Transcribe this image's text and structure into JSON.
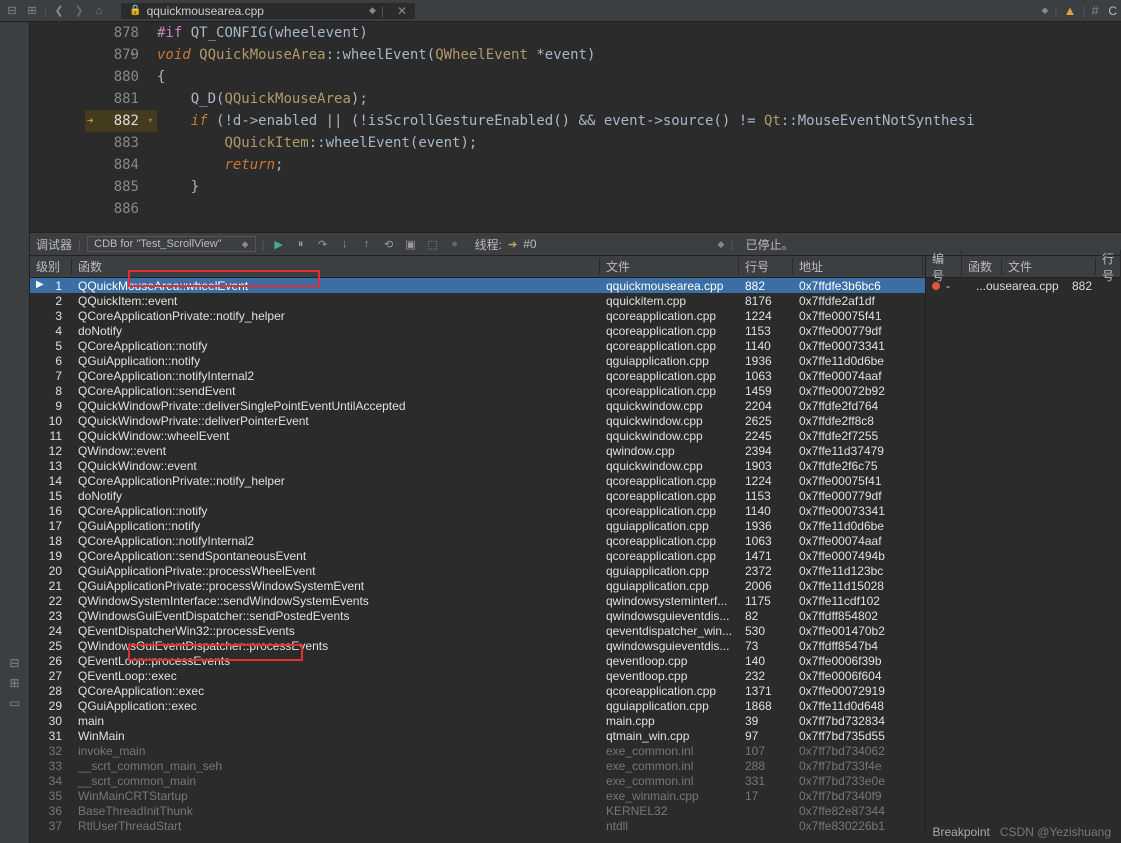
{
  "toolbar": {
    "filename": "qquickmousearea.cpp",
    "hash_label": "C"
  },
  "editor": {
    "lines": [
      {
        "num": "878",
        "html": "<span class='kw-pre'>#if</span> <span class='fn'>QT_CONFIG</span><span class='paren'>(</span><span class='fn'>wheelevent</span><span class='paren'>)</span>"
      },
      {
        "num": "879",
        "html": "<span class='kw'>void</span> <span class='type'>QQuickMouseArea</span><span class='str-op'>::</span><span class='fn'>wheelEvent</span><span class='paren'>(</span><span class='type'>QWheelEvent</span> <span class='str-op'>*</span><span class='fn'>event</span><span class='paren'>)</span>",
        "fold": true
      },
      {
        "num": "880",
        "html": "<span class='paren'>{</span>"
      },
      {
        "num": "881",
        "html": "    <span class='fn'>Q_D</span><span class='paren'>(</span><span class='type'>QQuickMouseArea</span><span class='paren'>);</span>"
      },
      {
        "num": "882",
        "html": "    <span class='kw'>if</span> <span class='paren'>(!</span><span class='fn'>d</span><span class='str-op'>-&gt;</span><span class='fn'>enabled</span> <span class='str-op'>||</span> <span class='paren'>(!</span><span class='fn'>isScrollGestureEnabled</span><span class='paren'>()</span> <span class='str-op'>&amp;&amp;</span> <span class='fn'>event</span><span class='str-op'>-&gt;</span><span class='fn'>source</span><span class='paren'>()</span> <span class='str-op'>!=</span> <span class='type'>Qt</span><span class='str-op'>::</span><span class='fn'>MouseEventNotSynthesi</span>",
        "arrow": true,
        "hl": true,
        "fold": true
      },
      {
        "num": "883",
        "html": "        <span class='type'>QQuickItem</span><span class='str-op'>::</span><span class='fn'>wheelEvent</span><span class='paren'>(</span><span class='fn'>event</span><span class='paren'>);</span>"
      },
      {
        "num": "884",
        "html": "        <span class='kw'>return</span><span class='paren'>;</span>"
      },
      {
        "num": "885",
        "html": "    <span class='paren'>}</span>"
      },
      {
        "num": "886",
        "html": ""
      }
    ]
  },
  "debugger": {
    "label": "调试器",
    "target": "CDB for \"Test_ScrollView\"",
    "threads_label": "线程:",
    "thread_num": "#0",
    "status": "已停止。"
  },
  "stack_headers": {
    "level": "级别",
    "func": "函数",
    "file": "文件",
    "line": "行号",
    "addr": "地址"
  },
  "side_headers": {
    "num": "编号",
    "func": "函数",
    "file": "文件",
    "line": "行号"
  },
  "side_row": {
    "dash": "-",
    "file": "...ousearea.cpp",
    "line": "882"
  },
  "stack": [
    {
      "lvl": "1",
      "fn": "QQuickMouseArea::wheelEvent",
      "file": "qquickmousearea.cpp",
      "line": "882",
      "addr": "0x7ffdfe3b6bc6",
      "sel": true,
      "ptr": true
    },
    {
      "lvl": "2",
      "fn": "QQuickItem::event",
      "file": "qquickitem.cpp",
      "line": "8176",
      "addr": "0x7ffdfe2af1df"
    },
    {
      "lvl": "3",
      "fn": "QCoreApplicationPrivate::notify_helper",
      "file": "qcoreapplication.cpp",
      "line": "1224",
      "addr": "0x7ffe00075f41"
    },
    {
      "lvl": "4",
      "fn": "doNotify",
      "file": "qcoreapplication.cpp",
      "line": "1153",
      "addr": "0x7ffe000779df"
    },
    {
      "lvl": "5",
      "fn": "QCoreApplication::notify",
      "file": "qcoreapplication.cpp",
      "line": "1140",
      "addr": "0x7ffe00073341"
    },
    {
      "lvl": "6",
      "fn": "QGuiApplication::notify",
      "file": "qguiapplication.cpp",
      "line": "1936",
      "addr": "0x7ffe11d0d6be"
    },
    {
      "lvl": "7",
      "fn": "QCoreApplication::notifyInternal2",
      "file": "qcoreapplication.cpp",
      "line": "1063",
      "addr": "0x7ffe00074aaf"
    },
    {
      "lvl": "8",
      "fn": "QCoreApplication::sendEvent",
      "file": "qcoreapplication.cpp",
      "line": "1459",
      "addr": "0x7ffe00072b92"
    },
    {
      "lvl": "9",
      "fn": "QQuickWindowPrivate::deliverSinglePointEventUntilAccepted",
      "file": "qquickwindow.cpp",
      "line": "2204",
      "addr": "0x7ffdfe2fd764"
    },
    {
      "lvl": "10",
      "fn": "QQuickWindowPrivate::deliverPointerEvent",
      "file": "qquickwindow.cpp",
      "line": "2625",
      "addr": "0x7ffdfe2ff8c8"
    },
    {
      "lvl": "11",
      "fn": "QQuickWindow::wheelEvent",
      "file": "qquickwindow.cpp",
      "line": "2245",
      "addr": "0x7ffdfe2f7255"
    },
    {
      "lvl": "12",
      "fn": "QWindow::event",
      "file": "qwindow.cpp",
      "line": "2394",
      "addr": "0x7ffe11d37479"
    },
    {
      "lvl": "13",
      "fn": "QQuickWindow::event",
      "file": "qquickwindow.cpp",
      "line": "1903",
      "addr": "0x7ffdfe2f6c75"
    },
    {
      "lvl": "14",
      "fn": "QCoreApplicationPrivate::notify_helper",
      "file": "qcoreapplication.cpp",
      "line": "1224",
      "addr": "0x7ffe00075f41"
    },
    {
      "lvl": "15",
      "fn": "doNotify",
      "file": "qcoreapplication.cpp",
      "line": "1153",
      "addr": "0x7ffe000779df"
    },
    {
      "lvl": "16",
      "fn": "QCoreApplication::notify",
      "file": "qcoreapplication.cpp",
      "line": "1140",
      "addr": "0x7ffe00073341"
    },
    {
      "lvl": "17",
      "fn": "QGuiApplication::notify",
      "file": "qguiapplication.cpp",
      "line": "1936",
      "addr": "0x7ffe11d0d6be"
    },
    {
      "lvl": "18",
      "fn": "QCoreApplication::notifyInternal2",
      "file": "qcoreapplication.cpp",
      "line": "1063",
      "addr": "0x7ffe00074aaf"
    },
    {
      "lvl": "19",
      "fn": "QCoreApplication::sendSpontaneousEvent",
      "file": "qcoreapplication.cpp",
      "line": "1471",
      "addr": "0x7ffe0007494b"
    },
    {
      "lvl": "20",
      "fn": "QGuiApplicationPrivate::processWheelEvent",
      "file": "qguiapplication.cpp",
      "line": "2372",
      "addr": "0x7ffe11d123bc"
    },
    {
      "lvl": "21",
      "fn": "QGuiApplicationPrivate::processWindowSystemEvent",
      "file": "qguiapplication.cpp",
      "line": "2006",
      "addr": "0x7ffe11d15028"
    },
    {
      "lvl": "22",
      "fn": "QWindowSystemInterface::sendWindowSystemEvents",
      "file": "qwindowsysteminterf...",
      "line": "1175",
      "addr": "0x7ffe11cdf102"
    },
    {
      "lvl": "23",
      "fn": "QWindowsGuiEventDispatcher::sendPostedEvents",
      "file": "qwindowsguieventdis...",
      "line": "82",
      "addr": "0x7ffdff854802"
    },
    {
      "lvl": "24",
      "fn": "QEventDispatcherWin32::processEvents",
      "file": "qeventdispatcher_win...",
      "line": "530",
      "addr": "0x7ffe001470b2"
    },
    {
      "lvl": "25",
      "fn": "QWindowsGuiEventDispatcher::processEvents",
      "file": "qwindowsguieventdis...",
      "line": "73",
      "addr": "0x7ffdff8547b4"
    },
    {
      "lvl": "26",
      "fn": "QEventLoop::processEvents",
      "file": "qeventloop.cpp",
      "line": "140",
      "addr": "0x7ffe0006f39b"
    },
    {
      "lvl": "27",
      "fn": "QEventLoop::exec",
      "file": "qeventloop.cpp",
      "line": "232",
      "addr": "0x7ffe0006f604"
    },
    {
      "lvl": "28",
      "fn": "QCoreApplication::exec",
      "file": "qcoreapplication.cpp",
      "line": "1371",
      "addr": "0x7ffe00072919"
    },
    {
      "lvl": "29",
      "fn": "QGuiApplication::exec",
      "file": "qguiapplication.cpp",
      "line": "1868",
      "addr": "0x7ffe11d0d648"
    },
    {
      "lvl": "30",
      "fn": "main",
      "file": "main.cpp",
      "line": "39",
      "addr": "0x7ff7bd732834"
    },
    {
      "lvl": "31",
      "fn": "WinMain",
      "file": "qtmain_win.cpp",
      "line": "97",
      "addr": "0x7ff7bd735d55"
    },
    {
      "lvl": "32",
      "fn": "invoke_main",
      "file": "exe_common.inl",
      "line": "107",
      "addr": "0x7ff7bd734062",
      "dim": true
    },
    {
      "lvl": "33",
      "fn": "__scrt_common_main_seh",
      "file": "exe_common.inl",
      "line": "288",
      "addr": "0x7ff7bd733f4e",
      "dim": true
    },
    {
      "lvl": "34",
      "fn": "__scrt_common_main",
      "file": "exe_common.inl",
      "line": "331",
      "addr": "0x7ff7bd733e0e",
      "dim": true
    },
    {
      "lvl": "35",
      "fn": "WinMainCRTStartup",
      "file": "exe_winmain.cpp",
      "line": "17",
      "addr": "0x7ff7bd7340f9",
      "dim": true
    },
    {
      "lvl": "36",
      "fn": "BaseThreadInitThunk",
      "file": "KERNEL32",
      "line": "",
      "addr": "0x7ffe82e87344",
      "dim": true
    },
    {
      "lvl": "37",
      "fn": "RtlUserThreadStart",
      "file": "ntdll",
      "line": "",
      "addr": "0x7ffe830226b1",
      "dim": true
    }
  ],
  "status": {
    "breakpoint": "Breakpoint",
    "watermark": "CSDN @Yezishuang"
  }
}
